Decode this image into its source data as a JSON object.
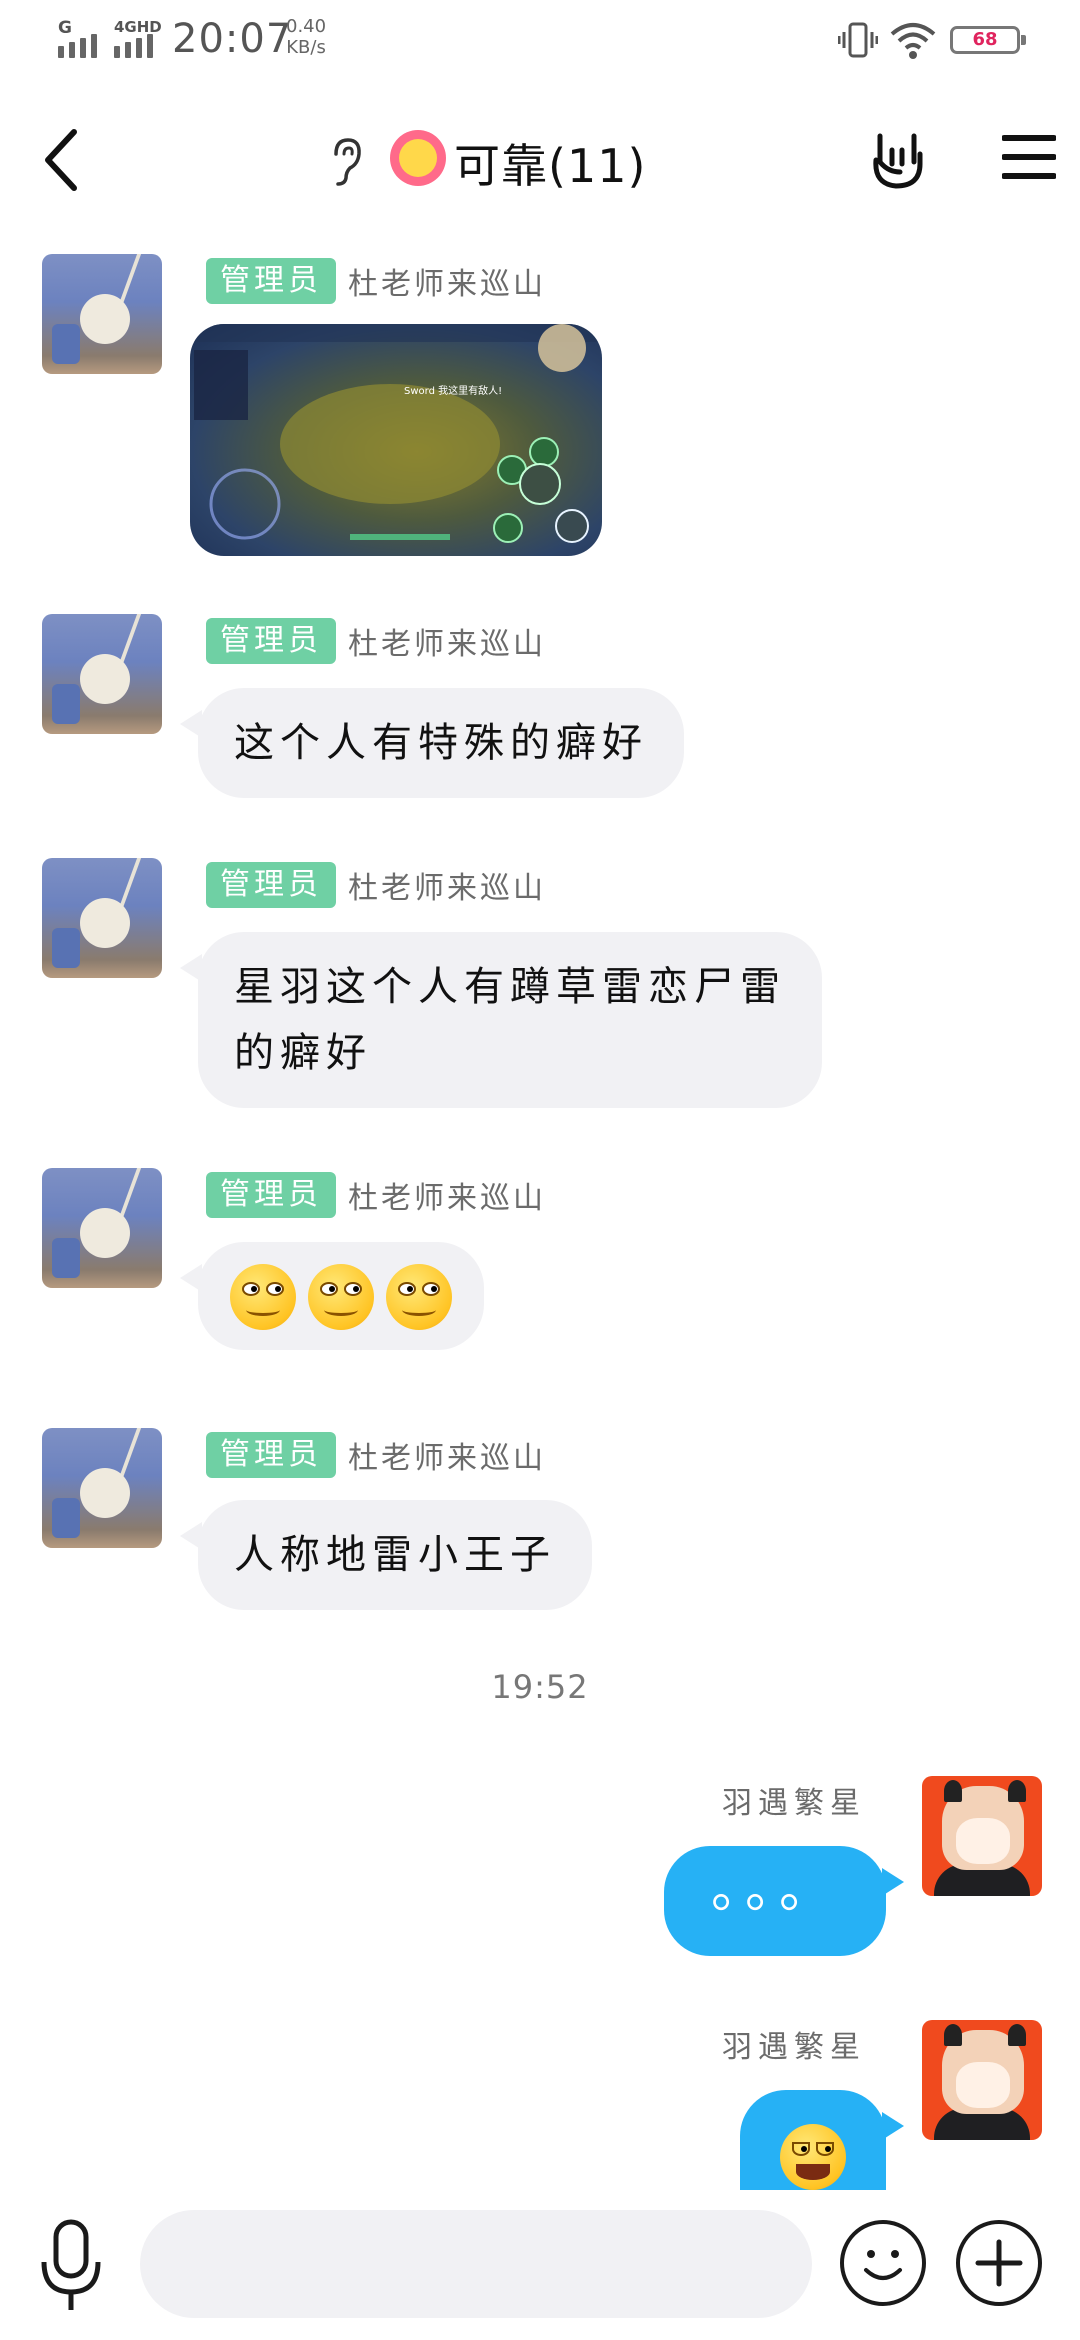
{
  "status_bar": {
    "network_label": "4GHD",
    "sim1_label": "G",
    "time": "20:07",
    "speed_value": "0.40",
    "speed_unit": "KB/s",
    "battery": "68"
  },
  "header": {
    "title": "可靠(11)"
  },
  "messages": [
    {
      "badge": "管理员",
      "sender": "杜老师来巡山",
      "type": "image",
      "image_caption": "Sword 我这里有敌人!"
    },
    {
      "badge": "管理员",
      "sender": "杜老师来巡山",
      "text": "这个人有特殊的癖好"
    },
    {
      "badge": "管理员",
      "sender": "杜老师来巡山",
      "line1": "星羽这个人有蹲草雷恋尸雷",
      "line2": "的癖好"
    },
    {
      "badge": "管理员",
      "sender": "杜老师来巡山",
      "type": "emoji"
    },
    {
      "badge": "管理员",
      "sender": "杜老师来巡山",
      "text": "人称地雷小王子"
    }
  ],
  "timestamp": "19:52",
  "outgoing": [
    {
      "sender": "羽遇繁星",
      "text": "。。。"
    },
    {
      "sender": "羽遇繁星",
      "type": "emoji"
    }
  ],
  "input": {
    "placeholder": ""
  }
}
